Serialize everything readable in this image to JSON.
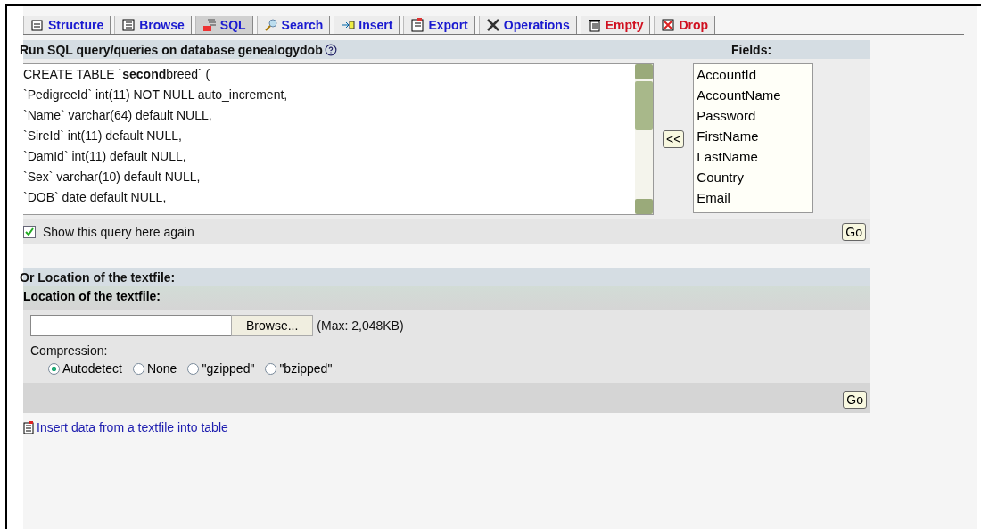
{
  "tabs": [
    {
      "label": "Structure",
      "kind": "normal",
      "selected": false
    },
    {
      "label": "Browse",
      "kind": "normal",
      "selected": false
    },
    {
      "label": "SQL",
      "kind": "normal",
      "selected": true
    },
    {
      "label": "Search",
      "kind": "normal",
      "selected": false
    },
    {
      "label": "Insert",
      "kind": "normal",
      "selected": false
    },
    {
      "label": "Export",
      "kind": "normal",
      "selected": false
    },
    {
      "label": "Operations",
      "kind": "normal",
      "selected": false
    },
    {
      "label": "Empty",
      "kind": "danger",
      "selected": false
    },
    {
      "label": "Drop",
      "kind": "danger",
      "selected": false
    }
  ],
  "query_panel": {
    "title": "Run SQL query/queries on database genealogydob",
    "fields_title": "Fields:",
    "query_lines": [
      "CREATE TABLE `**second**breed` (",
      "`PedigreeId` int(11) NOT NULL auto_increment,",
      "`Name` varchar(64) default NULL,",
      "`SireId` int(11) default NULL,",
      "`DamId` int(11) default NULL,",
      "`Sex` varchar(10) default NULL,",
      "`DOB` date default NULL,"
    ],
    "insert_button": "<<",
    "fields": [
      "AccountId",
      "AccountName",
      "Password",
      "FirstName",
      "LastName",
      "Country",
      "Email"
    ],
    "show_again": {
      "label": "Show this query here again",
      "checked": true
    },
    "go_button": "Go"
  },
  "file_panel": {
    "title": "Or Location of the textfile:",
    "subtitle": "Location of the textfile:",
    "browse_button": "Browse...",
    "max_note": "(Max: 2,048KB)",
    "compression_label": "Compression:",
    "compression_options": [
      {
        "label": "Autodetect",
        "selected": true
      },
      {
        "label": "None",
        "selected": false
      },
      {
        "label": "\"gzipped\"",
        "selected": false
      },
      {
        "label": "\"bzipped\"",
        "selected": false
      }
    ],
    "go_button": "Go"
  },
  "footer_link": "Insert data from a textfile into table"
}
